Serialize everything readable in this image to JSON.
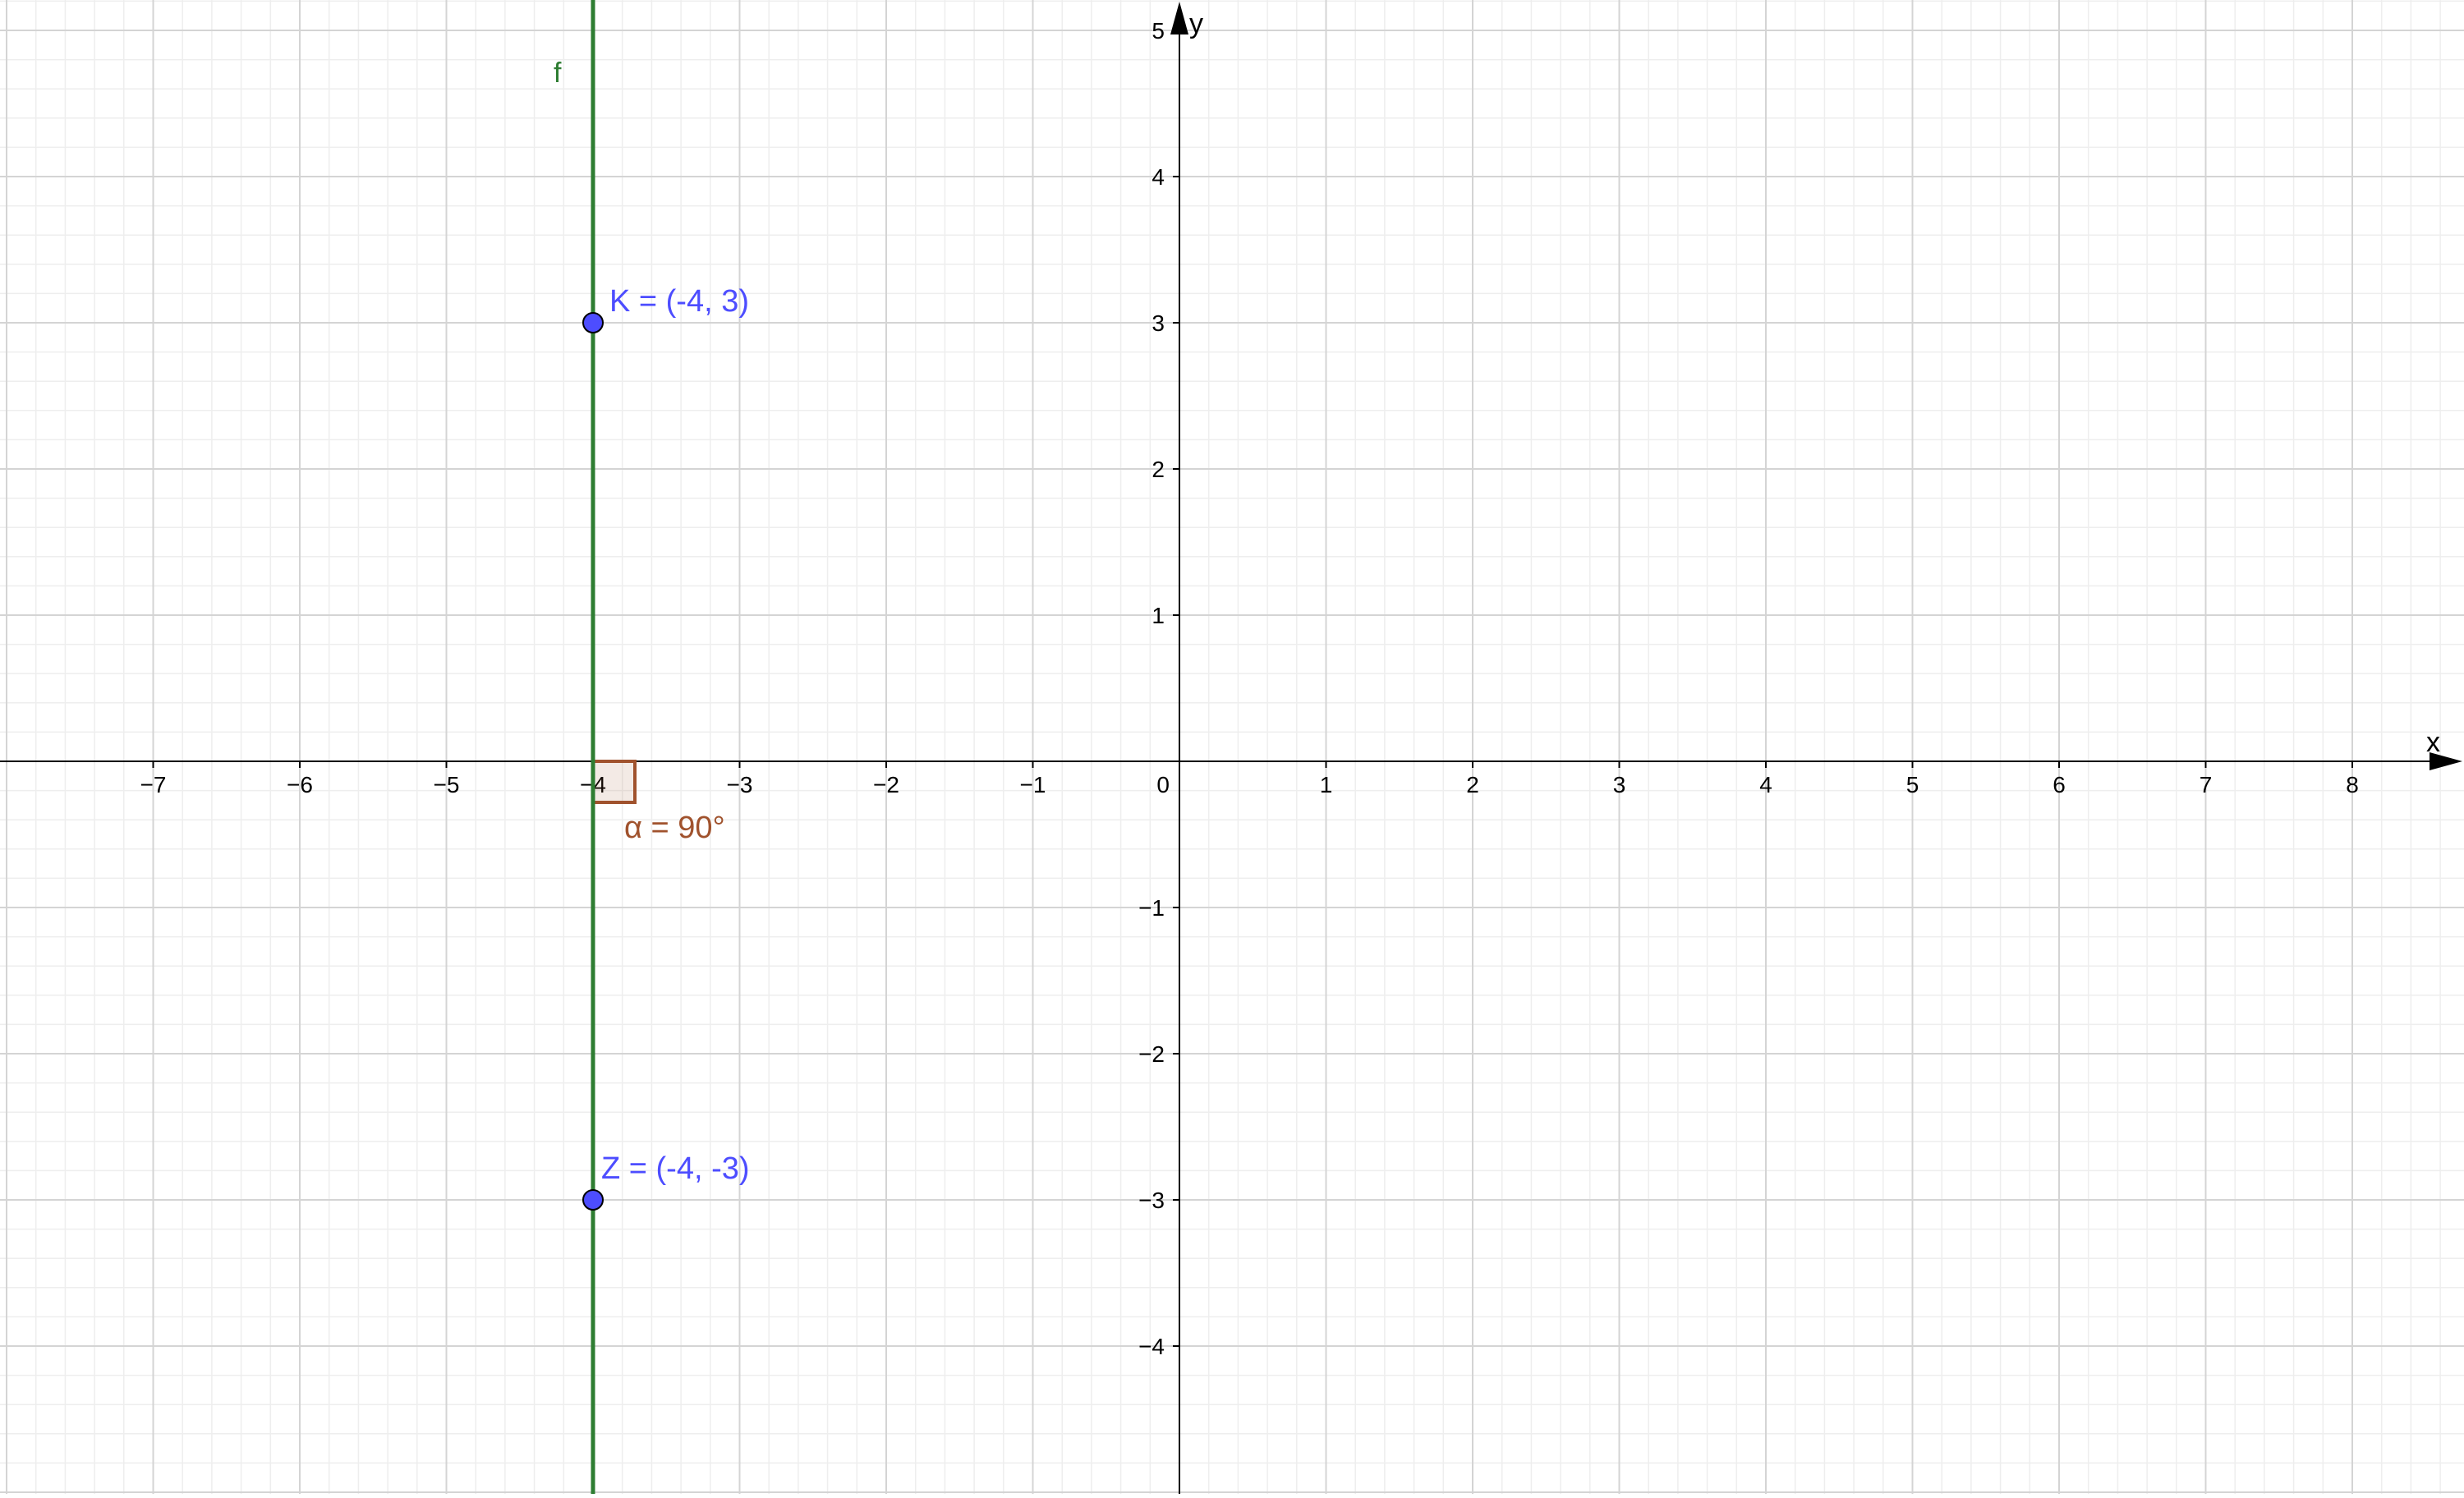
{
  "graph": {
    "x_axis_label": "x",
    "y_axis_label": "y",
    "x_range": [
      -8,
      8.8
    ],
    "y_range": [
      -5,
      5.2
    ],
    "x_ticks": [
      {
        "value": -7,
        "label": "−7"
      },
      {
        "value": -6,
        "label": "−6"
      },
      {
        "value": -5,
        "label": "−5"
      },
      {
        "value": -4,
        "label": "−4"
      },
      {
        "value": -3,
        "label": "−3"
      },
      {
        "value": -2,
        "label": "−2"
      },
      {
        "value": -1,
        "label": "−1"
      },
      {
        "value": 1,
        "label": "1"
      },
      {
        "value": 2,
        "label": "2"
      },
      {
        "value": 3,
        "label": "3"
      },
      {
        "value": 4,
        "label": "4"
      },
      {
        "value": 5,
        "label": "5"
      },
      {
        "value": 6,
        "label": "6"
      },
      {
        "value": 7,
        "label": "7"
      },
      {
        "value": 8,
        "label": "8"
      }
    ],
    "y_ticks": [
      {
        "value": 5,
        "label": "5"
      },
      {
        "value": 4,
        "label": "4"
      },
      {
        "value": 3,
        "label": "3"
      },
      {
        "value": 2,
        "label": "2"
      },
      {
        "value": 1,
        "label": "1"
      },
      {
        "value": -1,
        "label": "−1"
      },
      {
        "value": -2,
        "label": "−2"
      },
      {
        "value": -3,
        "label": "−3"
      },
      {
        "value": -4,
        "label": "−4"
      }
    ],
    "origin_label": "0",
    "major_grid": true,
    "minor_grid": true,
    "grid_color": "#d4d4d4",
    "minor_grid_color": "#eeeeee",
    "axis_color": "#000000"
  },
  "objects": {
    "line_f": {
      "name": "f",
      "x": -4,
      "color": "#2e7d32"
    },
    "point_K": {
      "label": "K = (-4, 3)",
      "x": -4,
      "y": 3,
      "color": "#4d4dff"
    },
    "point_Z": {
      "label": "Z = (-4, -3)",
      "x": -4,
      "y": -3,
      "color": "#4d4dff"
    },
    "angle_alpha": {
      "label": "α = 90°",
      "vertex_x": -4,
      "vertex_y": 0,
      "value_deg": 90,
      "color": "#a0522d"
    }
  }
}
